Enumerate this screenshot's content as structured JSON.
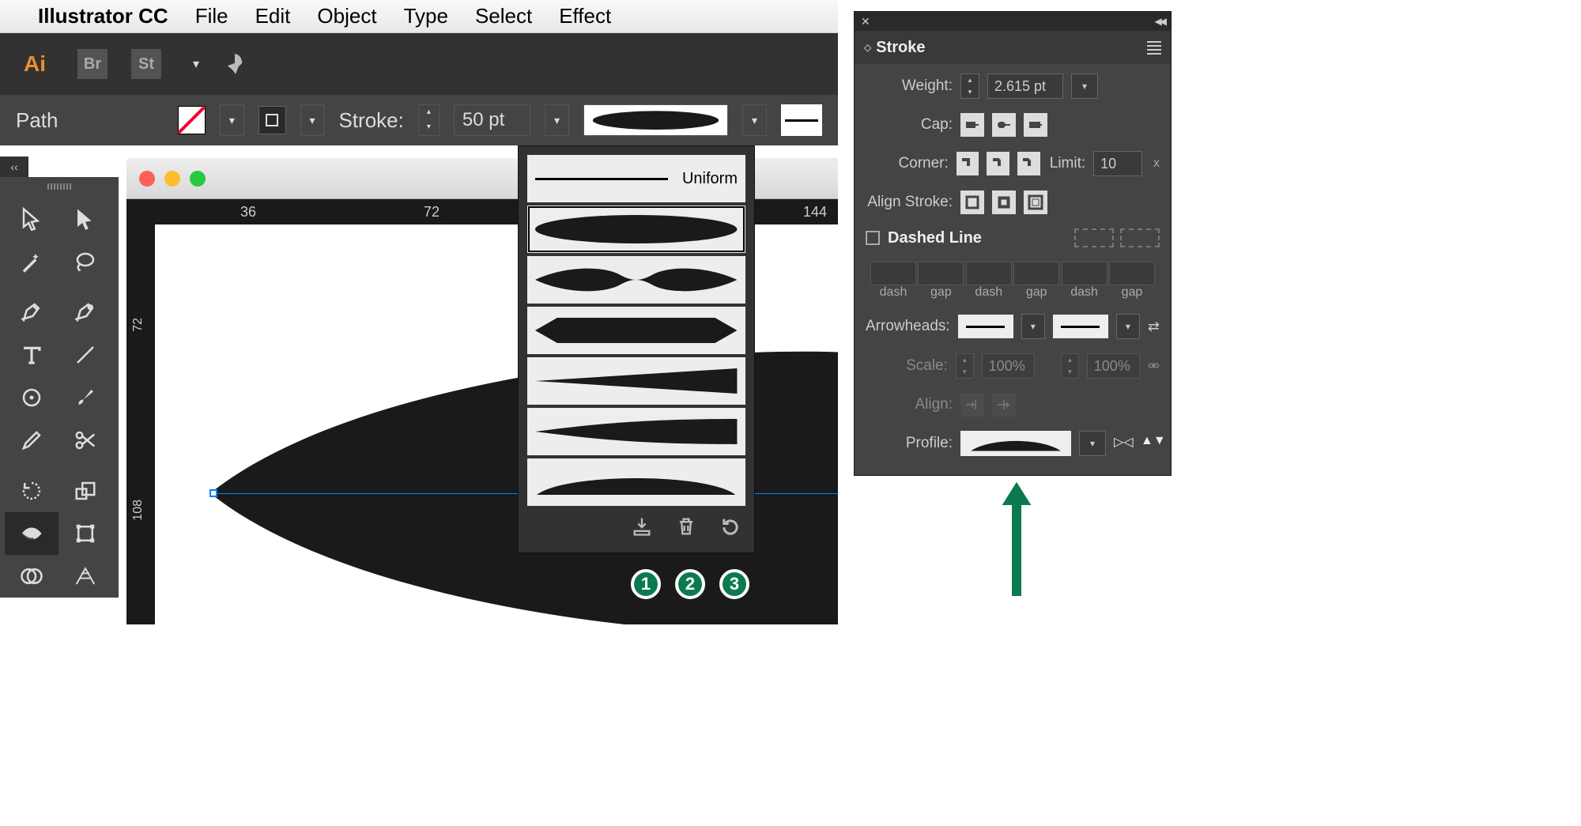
{
  "menubar": {
    "app": "Illustrator CC",
    "items": [
      "File",
      "Edit",
      "Object",
      "Type",
      "Select",
      "Effect"
    ]
  },
  "appbar": {
    "logo": "Ai",
    "br": "Br",
    "st": "St"
  },
  "ctrlbar": {
    "context": "Path",
    "stroke_label": "Stroke:",
    "stroke_value": "50 pt"
  },
  "ruler": {
    "h": [
      "36",
      "72",
      "144"
    ],
    "v": [
      "72",
      "108"
    ]
  },
  "popup": {
    "uniform": "Uniform"
  },
  "badges": [
    "1",
    "2",
    "3"
  ],
  "panel": {
    "title": "Stroke",
    "weight_label": "Weight:",
    "weight_value": "2.615 pt",
    "cap_label": "Cap:",
    "corner_label": "Corner:",
    "limit_label": "Limit:",
    "limit_value": "10",
    "align_stroke_label": "Align Stroke:",
    "dashed_label": "Dashed Line",
    "dash_labels": [
      "dash",
      "gap",
      "dash",
      "gap",
      "dash",
      "gap"
    ],
    "arrowheads_label": "Arrowheads:",
    "scale_label": "Scale:",
    "scale_value": "100%",
    "align_label": "Align:",
    "profile_label": "Profile:"
  }
}
